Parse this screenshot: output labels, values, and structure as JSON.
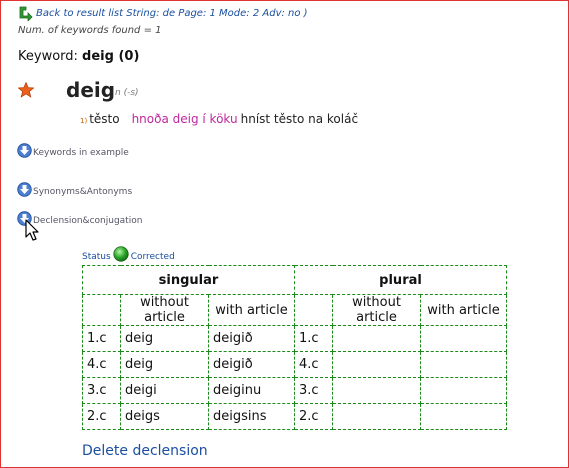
{
  "nav": {
    "back_link": "Back to result list String: de Page: 1 Mode: 2 Adv: no )",
    "num_found": "Num. of keywords found = 1"
  },
  "keyword": {
    "prefix": "Keyword: ",
    "value": "deig (0)"
  },
  "entry": {
    "headword": "deig",
    "grammar": "n (-s)",
    "senses": [
      {
        "num": "1)",
        "translation": "těsto",
        "example_is": "hnoða deig í köku",
        "example_cs": "hníst těsto na koláč"
      }
    ]
  },
  "sections": {
    "keywords_in_example": "Keywords in example",
    "synonyms": "Synonyms&Antonyms",
    "declension": "Declension&conjugation"
  },
  "status": {
    "label": "Status",
    "value": "Corrected",
    "color": "#2aa52a"
  },
  "declension_table": {
    "groups": [
      "singular",
      "plural"
    ],
    "subheaders": [
      "without article",
      "with article",
      "without article",
      "with article"
    ],
    "rows": [
      {
        "case": "1.c",
        "sg_indef": "deig",
        "sg_def": "deigið",
        "pl_case": "1.c",
        "pl_indef": "",
        "pl_def": ""
      },
      {
        "case": "4.c",
        "sg_indef": "deig",
        "sg_def": "deigið",
        "pl_case": "4.c",
        "pl_indef": "",
        "pl_def": ""
      },
      {
        "case": "3.c",
        "sg_indef": "deigi",
        "sg_def": "deiginu",
        "pl_case": "3.c",
        "pl_indef": "",
        "pl_def": ""
      },
      {
        "case": "2.c",
        "sg_indef": "deigs",
        "sg_def": "deigsins",
        "pl_case": "2.c",
        "pl_indef": "",
        "pl_def": ""
      }
    ]
  },
  "actions": {
    "delete_declension": "Delete declension"
  },
  "colors": {
    "frame": "#dd3333",
    "link": "#1a4fa0",
    "table_border": "#1a8a1a",
    "example": "#c0279e"
  },
  "icons": [
    "back-arrow-icon",
    "star-icon",
    "expand-down-arrow-icon",
    "status-green-dot-icon",
    "mouse-cursor-icon"
  ]
}
